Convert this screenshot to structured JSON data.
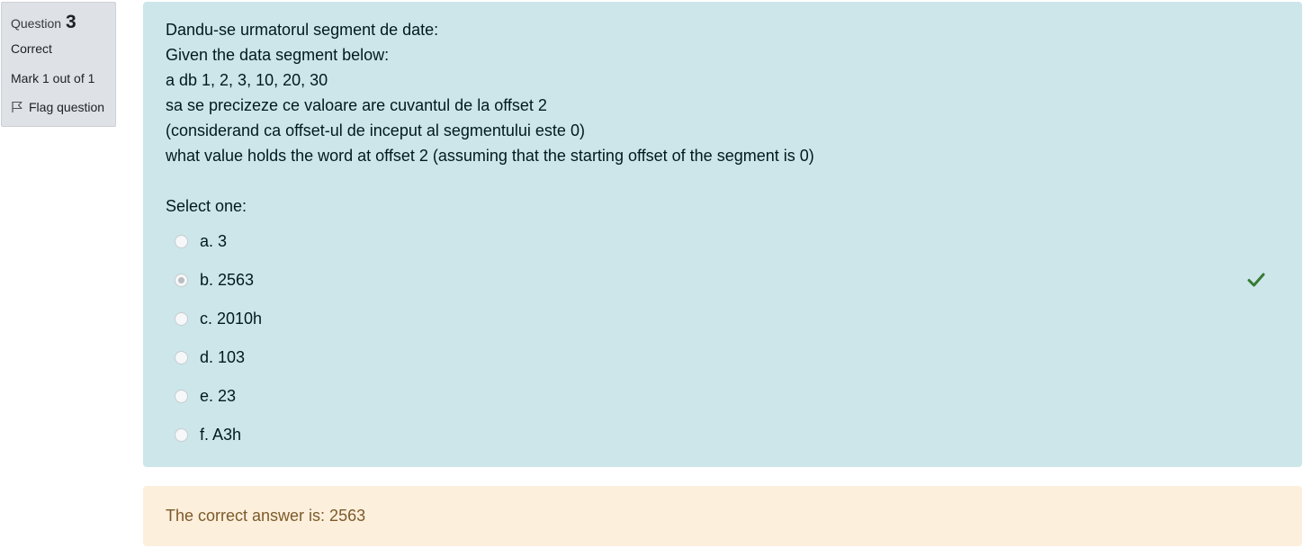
{
  "info": {
    "question_label": "Question",
    "question_number": "3",
    "state": "Correct",
    "grade": "Mark 1 out of 1",
    "flag_label": "Flag question"
  },
  "question": {
    "lines": [
      "Dandu-se urmatorul segment de date:",
      "Given the data segment below:",
      "a db 1, 2, 3, 10, 20, 30",
      "sa se precizeze ce valoare are cuvantul de la offset 2",
      "(considerand ca offset-ul de inceput al segmentului este 0)",
      "what value holds the word at offset 2 (assuming that the starting offset of the segment is 0)"
    ],
    "prompt": "Select one:",
    "options": [
      {
        "label": "a. 3",
        "selected": false
      },
      {
        "label": "b. 2563",
        "selected": true,
        "correct": true
      },
      {
        "label": "c. 2010h",
        "selected": false
      },
      {
        "label": "d. 103",
        "selected": false
      },
      {
        "label": "e. 23",
        "selected": false
      },
      {
        "label": "f. A3h",
        "selected": false
      }
    ]
  },
  "feedback": {
    "right_answer": "The correct answer is: 2563"
  },
  "colors": {
    "info_bg": "#dee2e6",
    "content_bg": "#cce6ea",
    "feedback_bg": "#fcefdc",
    "feedback_text": "#7d5a29",
    "check": "#357a32"
  },
  "icons": {
    "flag": "flag-icon",
    "correct": "check-icon"
  }
}
